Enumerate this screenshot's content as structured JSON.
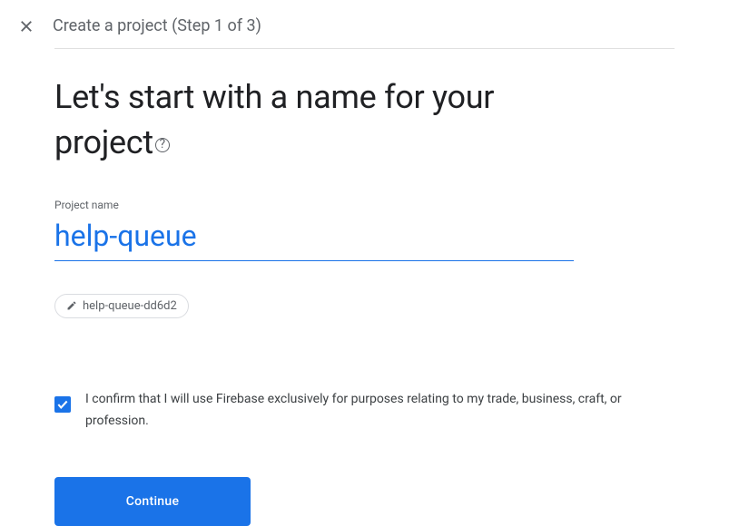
{
  "header": {
    "title": "Create a project (Step 1 of 3)"
  },
  "heading": "Let's start with a name for your project",
  "field": {
    "label": "Project name",
    "value": "help-queue"
  },
  "chip": {
    "id": "help-queue-dd6d2"
  },
  "confirm": {
    "checked": true,
    "text": "I confirm that I will use Firebase exclusively for purposes relating to my trade, business, craft, or profession."
  },
  "buttons": {
    "continue": "Continue"
  }
}
